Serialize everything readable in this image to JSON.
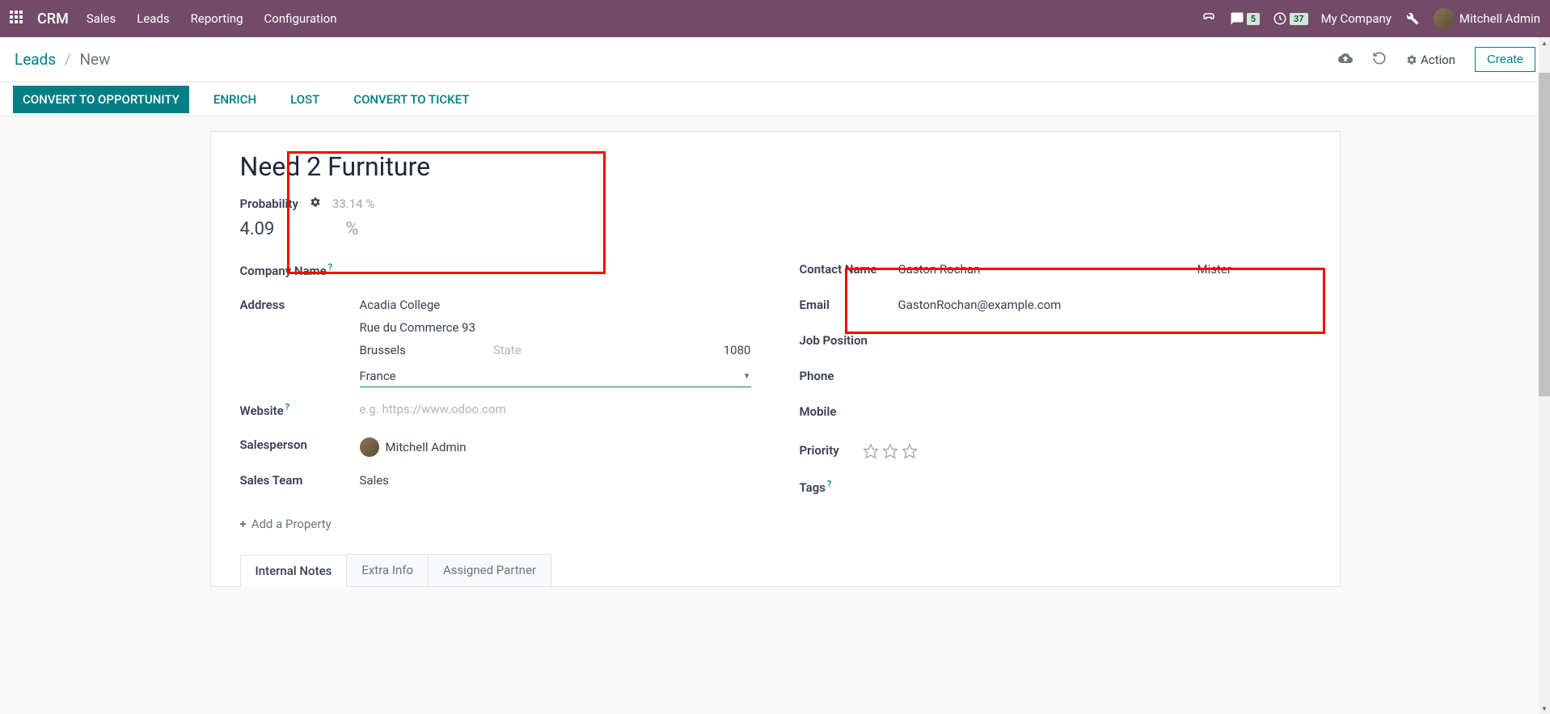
{
  "nav": {
    "brand": "CRM",
    "menu": [
      "Sales",
      "Leads",
      "Reporting",
      "Configuration"
    ],
    "msg_badge": "5",
    "clock_badge": "37",
    "company": "My Company",
    "user": "Mitchell Admin"
  },
  "breadcrumb": {
    "parent": "Leads",
    "current": "New",
    "action_label": "Action",
    "create_label": "Create"
  },
  "status_buttons": {
    "convert": "CONVERT TO OPPORTUNITY",
    "enrich": "ENRICH",
    "lost": "LOST",
    "convert_ticket": "CONVERT TO TICKET"
  },
  "form": {
    "title": "Need 2 Furniture",
    "probability_label": "Probability",
    "probability_auto": "33.14 %",
    "probability_value": "4.09",
    "percent_sign": "%",
    "labels": {
      "company_name": "Company Name",
      "address": "Address",
      "website": "Website",
      "salesperson": "Salesperson",
      "sales_team": "Sales Team",
      "contact_name": "Contact Name",
      "email": "Email",
      "job_position": "Job Position",
      "phone": "Phone",
      "mobile": "Mobile",
      "priority": "Priority",
      "tags": "Tags"
    },
    "address": {
      "name": "Acadia College",
      "street": "Rue du Commerce 93",
      "city": "Brussels",
      "state_placeholder": "State",
      "zip": "1080",
      "country": "France"
    },
    "website_placeholder": "e.g. https://www.odoo.com",
    "salesperson": "Mitchell Admin",
    "sales_team": "Sales",
    "add_property": "Add a Property",
    "contact_name": "Gaston Rochan",
    "contact_title": "Mister",
    "email": "GastonRochan@example.com"
  },
  "tabs": [
    "Internal Notes",
    "Extra Info",
    "Assigned Partner"
  ]
}
